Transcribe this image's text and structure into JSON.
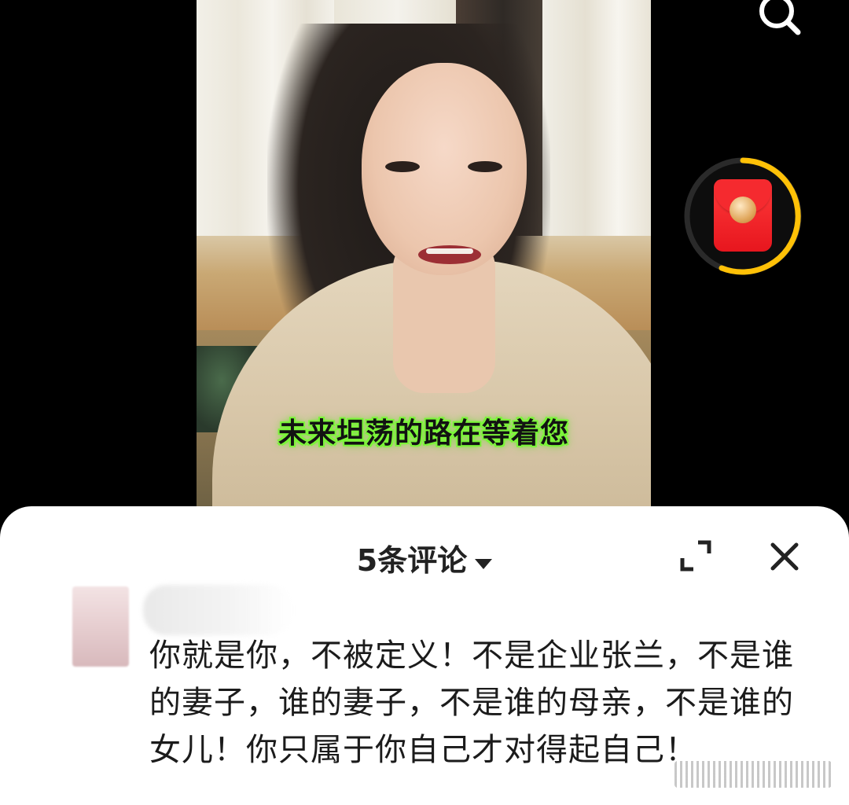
{
  "video": {
    "subtitle": "未来坦荡的路在等着您"
  },
  "overlay": {
    "search_icon": "search-icon",
    "red_packet_icon": "red-packet-icon",
    "progress_ring_color": "#ffc107"
  },
  "comments_panel": {
    "title": "5条评论",
    "dropdown_icon": "caret-down-icon",
    "expand_icon": "expand-icon",
    "close_icon": "close-icon",
    "comments": [
      {
        "text": "你就是你，不被定义！不是企业张兰，不是谁的妻子，谁的妻子，不是谁的母亲，不是谁的女儿！你只属于你自己才对得起自己！"
      }
    ]
  },
  "colors": {
    "subtitle_glow": "#7cf53a",
    "sheet_bg": "#ffffff",
    "text": "#1b1b1b"
  }
}
